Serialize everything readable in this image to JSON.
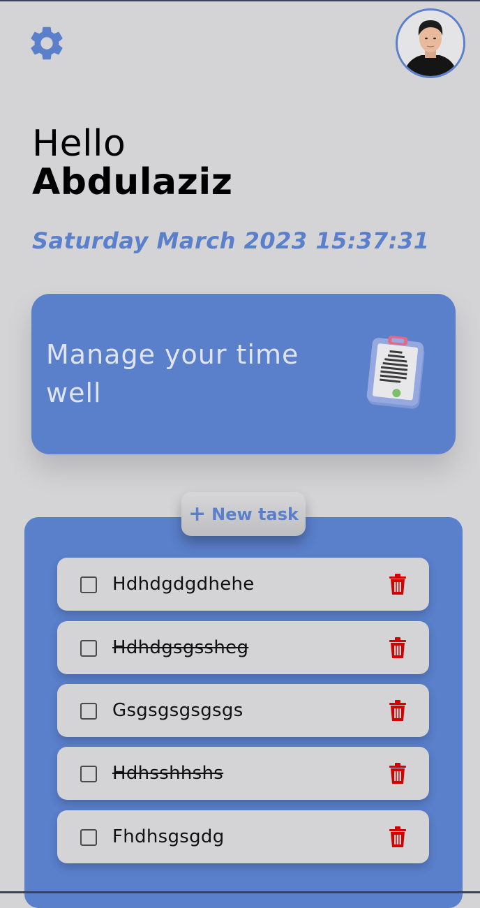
{
  "header": {
    "settings_icon": "gear-icon",
    "avatar_icon": "user-avatar"
  },
  "greeting": {
    "hello": "Hello",
    "name": "Abdulaziz"
  },
  "datetime": "Saturday March 2023 15:37:31",
  "banner": {
    "text": "Manage your time well",
    "icon": "clipboard-icon"
  },
  "new_task": {
    "plus": "+",
    "label": "New task"
  },
  "tasks": [
    {
      "label": "Hdhdgdgdhehe",
      "done": false
    },
    {
      "label": "Hdhdgsgssheg",
      "done": true
    },
    {
      "label": "Gsgsgsgsgsgs",
      "done": false
    },
    {
      "label": "Hdhsshhshs",
      "done": true
    },
    {
      "label": "Fhdhsgsgdg",
      "done": false
    }
  ],
  "colors": {
    "background": "#d4d4d6",
    "accent": "#5a7fcb",
    "delete": "#d40000"
  }
}
